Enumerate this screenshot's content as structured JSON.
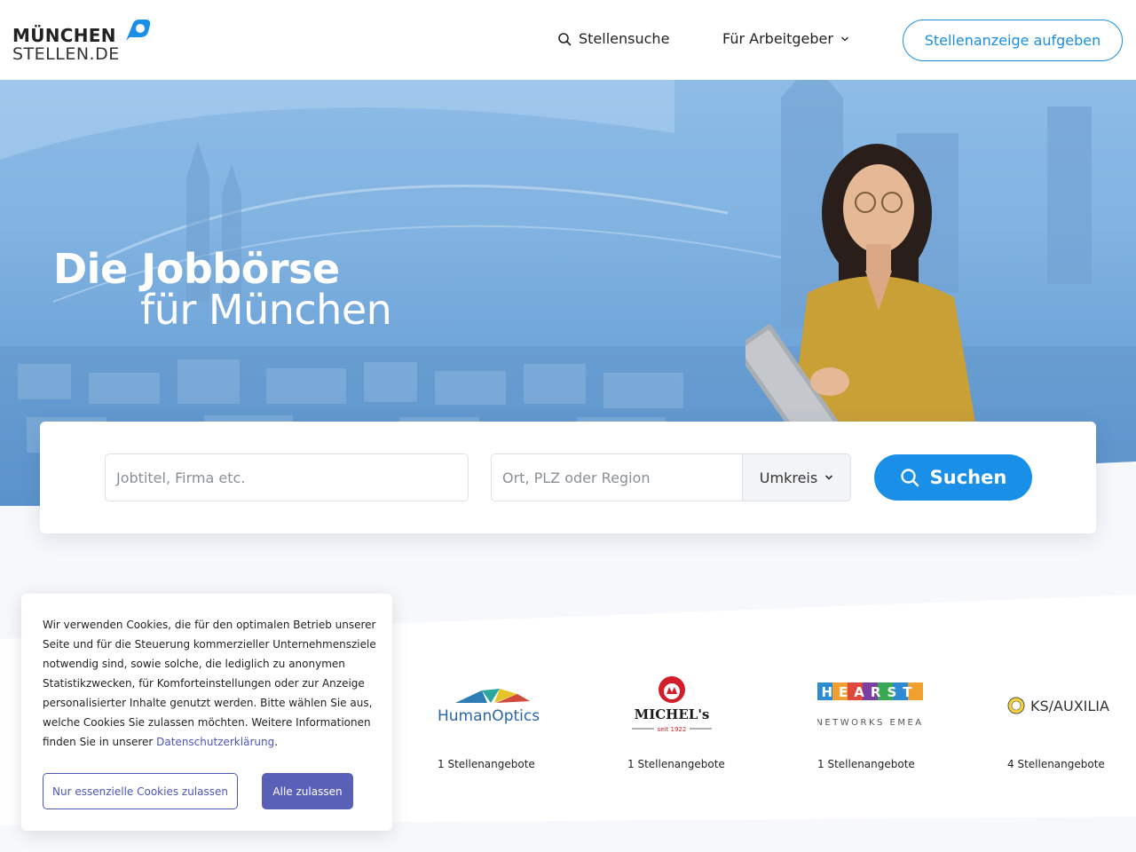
{
  "header": {
    "logo_line1": "MÜNCHEN",
    "logo_line2": "STELLEN.DE",
    "nav_search_label": "Stellensuche",
    "nav_employer_label": "Für Arbeitgeber",
    "cta_label": "Stellenanzeige aufgeben"
  },
  "hero": {
    "title": "Die Jobbörse",
    "subtitle": "für München"
  },
  "search": {
    "job_placeholder": "Jobtitel, Firma etc.",
    "location_placeholder": "Ort, PLZ oder Region",
    "radius_label": "Umkreis",
    "button_label": "Suchen"
  },
  "companies": [
    {
      "name": "HumanOptics",
      "count": "1 Stellenangebote"
    },
    {
      "name": "MICHEL's",
      "tagline": "seit 1922",
      "count": "1 Stellenangebote"
    },
    {
      "name": "HEARST",
      "tagline": "NETWORKS EMEA",
      "count": "1 Stellenangebote"
    },
    {
      "name": "KS/AUXILIA",
      "count": "4 Stellenangebote"
    }
  ],
  "cookie": {
    "text": "Wir verwenden Cookies, die für den optimalen Betrieb unserer Seite und für die Steuerung kommerzieller Unternehmensziele notwendig sind, sowie solche, die lediglich zu anonymen Statistikzwecken, für Komforteinstellungen oder zur Anzeige personalisierter Inhalte genutzt werden. Bitte wählen Sie aus, welche Cookies Sie zulassen möchten. Weitere Informationen finden Sie in unserer ",
    "link_label": "Datenschutzerklärung",
    "link_suffix": ".",
    "essential_button": "Nur essenzielle Cookies zulassen",
    "all_button": "Alle zulassen"
  },
  "colors": {
    "accent": "#1a8fe8",
    "cookie_accent": "#5a60b8"
  }
}
